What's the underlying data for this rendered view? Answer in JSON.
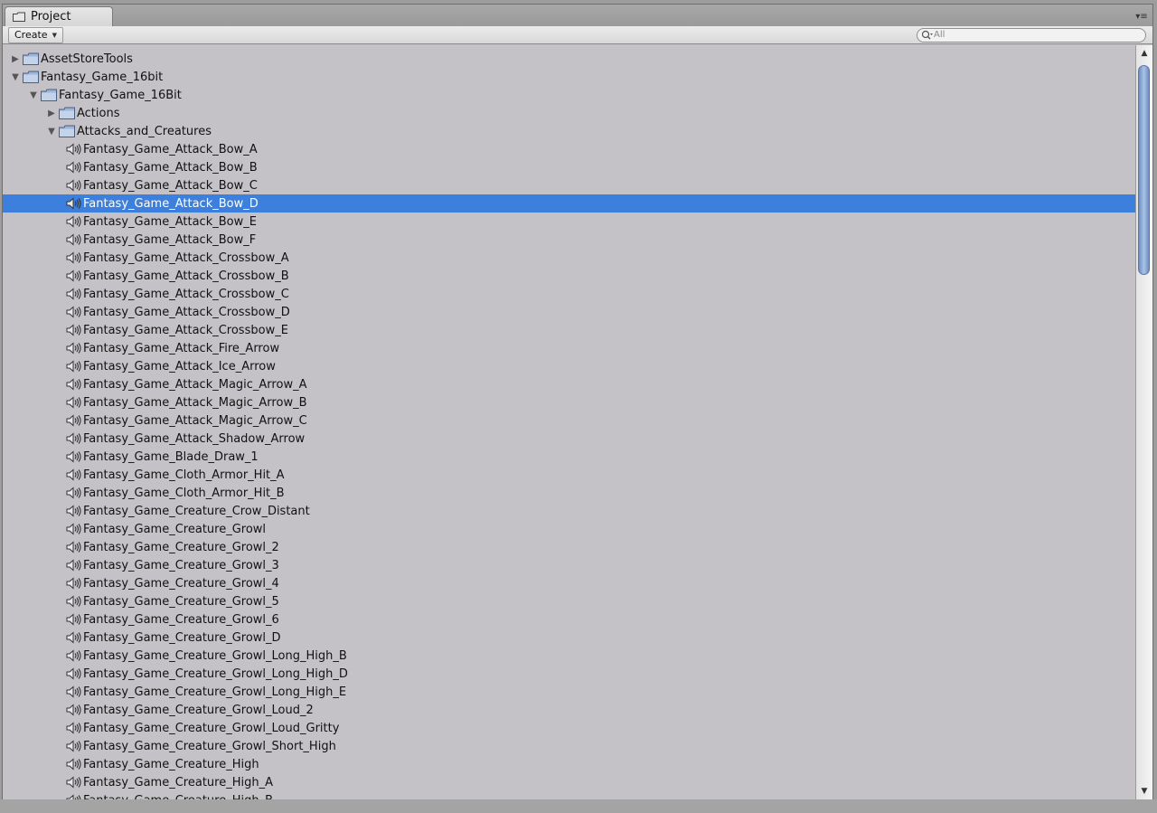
{
  "window": {
    "tab_label": "Project",
    "create_label": "Create",
    "search_placeholder": "All"
  },
  "colors": {
    "selection": "#3c7fdc",
    "list_background": "#c4c2c6",
    "scroll_thumb": "#8eaedd"
  },
  "tree": [
    {
      "label": "AssetStoreTools",
      "type": "folder",
      "depth": 0,
      "expanded": false
    },
    {
      "label": "Fantasy_Game_16bit",
      "type": "folder",
      "depth": 0,
      "expanded": true
    },
    {
      "label": "Fantasy_Game_16Bit",
      "type": "folder",
      "depth": 1,
      "expanded": true
    },
    {
      "label": "Actions",
      "type": "folder",
      "depth": 2,
      "expanded": false
    },
    {
      "label": "Attacks_and_Creatures",
      "type": "folder",
      "depth": 2,
      "expanded": true
    },
    {
      "label": "Fantasy_Game_Attack_Bow_A",
      "type": "audio",
      "depth": 3
    },
    {
      "label": "Fantasy_Game_Attack_Bow_B",
      "type": "audio",
      "depth": 3
    },
    {
      "label": "Fantasy_Game_Attack_Bow_C",
      "type": "audio",
      "depth": 3
    },
    {
      "label": "Fantasy_Game_Attack_Bow_D",
      "type": "audio",
      "depth": 3,
      "selected": true
    },
    {
      "label": "Fantasy_Game_Attack_Bow_E",
      "type": "audio",
      "depth": 3
    },
    {
      "label": "Fantasy_Game_Attack_Bow_F",
      "type": "audio",
      "depth": 3
    },
    {
      "label": "Fantasy_Game_Attack_Crossbow_A",
      "type": "audio",
      "depth": 3
    },
    {
      "label": "Fantasy_Game_Attack_Crossbow_B",
      "type": "audio",
      "depth": 3
    },
    {
      "label": "Fantasy_Game_Attack_Crossbow_C",
      "type": "audio",
      "depth": 3
    },
    {
      "label": "Fantasy_Game_Attack_Crossbow_D",
      "type": "audio",
      "depth": 3
    },
    {
      "label": "Fantasy_Game_Attack_Crossbow_E",
      "type": "audio",
      "depth": 3
    },
    {
      "label": "Fantasy_Game_Attack_Fire_Arrow",
      "type": "audio",
      "depth": 3
    },
    {
      "label": "Fantasy_Game_Attack_Ice_Arrow",
      "type": "audio",
      "depth": 3
    },
    {
      "label": "Fantasy_Game_Attack_Magic_Arrow_A",
      "type": "audio",
      "depth": 3
    },
    {
      "label": "Fantasy_Game_Attack_Magic_Arrow_B",
      "type": "audio",
      "depth": 3
    },
    {
      "label": "Fantasy_Game_Attack_Magic_Arrow_C",
      "type": "audio",
      "depth": 3
    },
    {
      "label": "Fantasy_Game_Attack_Shadow_Arrow",
      "type": "audio",
      "depth": 3
    },
    {
      "label": "Fantasy_Game_Blade_Draw_1",
      "type": "audio",
      "depth": 3
    },
    {
      "label": "Fantasy_Game_Cloth_Armor_Hit_A",
      "type": "audio",
      "depth": 3
    },
    {
      "label": "Fantasy_Game_Cloth_Armor_Hit_B",
      "type": "audio",
      "depth": 3
    },
    {
      "label": "Fantasy_Game_Creature_Crow_Distant",
      "type": "audio",
      "depth": 3
    },
    {
      "label": "Fantasy_Game_Creature_Growl",
      "type": "audio",
      "depth": 3
    },
    {
      "label": "Fantasy_Game_Creature_Growl_2",
      "type": "audio",
      "depth": 3
    },
    {
      "label": "Fantasy_Game_Creature_Growl_3",
      "type": "audio",
      "depth": 3
    },
    {
      "label": "Fantasy_Game_Creature_Growl_4",
      "type": "audio",
      "depth": 3
    },
    {
      "label": "Fantasy_Game_Creature_Growl_5",
      "type": "audio",
      "depth": 3
    },
    {
      "label": "Fantasy_Game_Creature_Growl_6",
      "type": "audio",
      "depth": 3
    },
    {
      "label": "Fantasy_Game_Creature_Growl_D",
      "type": "audio",
      "depth": 3
    },
    {
      "label": "Fantasy_Game_Creature_Growl_Long_High_B",
      "type": "audio",
      "depth": 3
    },
    {
      "label": "Fantasy_Game_Creature_Growl_Long_High_D",
      "type": "audio",
      "depth": 3
    },
    {
      "label": "Fantasy_Game_Creature_Growl_Long_High_E",
      "type": "audio",
      "depth": 3
    },
    {
      "label": "Fantasy_Game_Creature_Growl_Loud_2",
      "type": "audio",
      "depth": 3
    },
    {
      "label": "Fantasy_Game_Creature_Growl_Loud_Gritty",
      "type": "audio",
      "depth": 3
    },
    {
      "label": "Fantasy_Game_Creature_Growl_Short_High",
      "type": "audio",
      "depth": 3
    },
    {
      "label": "Fantasy_Game_Creature_High",
      "type": "audio",
      "depth": 3
    },
    {
      "label": "Fantasy_Game_Creature_High_A",
      "type": "audio",
      "depth": 3
    },
    {
      "label": "Fantasy_Game_Creature_High_B",
      "type": "audio",
      "depth": 3
    }
  ]
}
